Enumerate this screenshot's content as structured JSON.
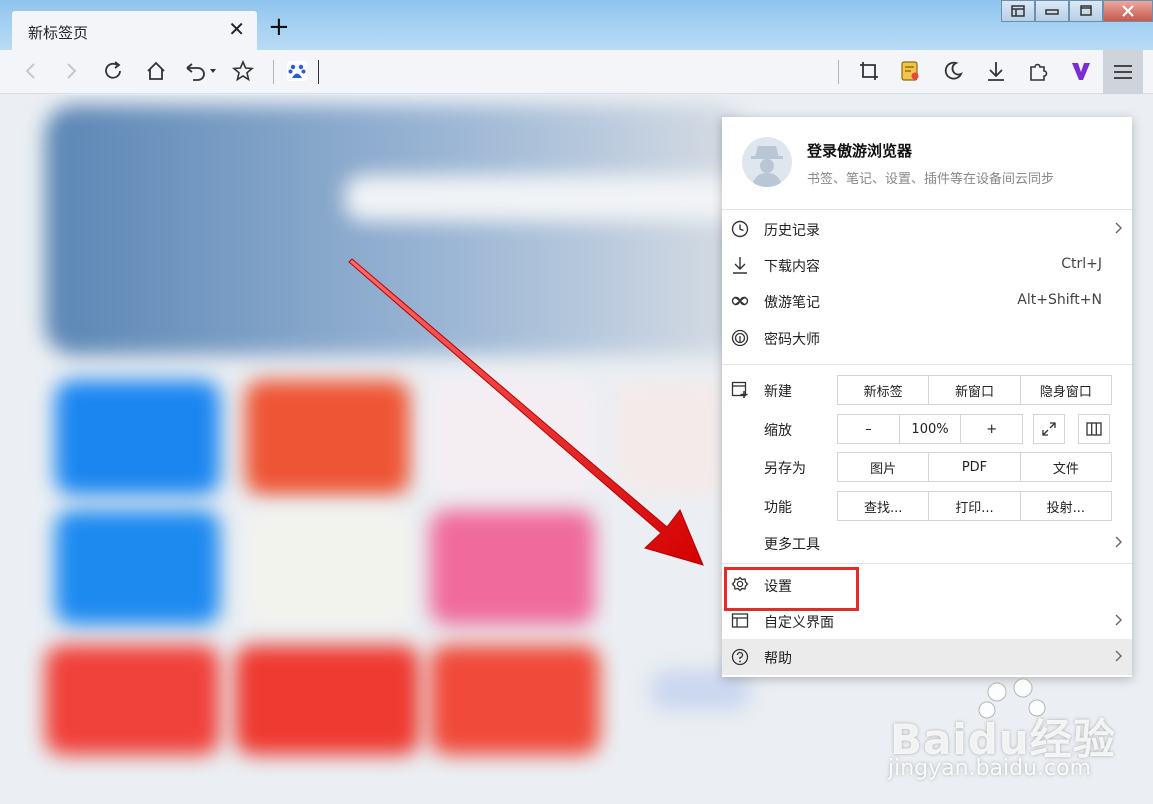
{
  "tab": {
    "title": "新标签页",
    "close": "✕"
  },
  "new_tab": "+",
  "menu": {
    "account": {
      "title": "登录傲游浏览器",
      "subtitle": "书签、笔记、设置、插件等在设备间云同步"
    },
    "items": {
      "history": {
        "label": "历史记录"
      },
      "downloads": {
        "label": "下载内容",
        "shortcut": "Ctrl+J"
      },
      "notes": {
        "label": "傲游笔记",
        "shortcut": "Alt+Shift+N"
      },
      "passwords": {
        "label": "密码大师"
      },
      "new": {
        "label": "新建",
        "options": [
          "新标签",
          "新窗口",
          "隐身窗口"
        ]
      },
      "zoom": {
        "label": "缩放",
        "minus": "–",
        "level": "100%",
        "plus": "+"
      },
      "save_as": {
        "label": "另存为",
        "options": [
          "图片",
          "PDF",
          "文件"
        ]
      },
      "functions": {
        "label": "功能",
        "options": [
          "查找...",
          "打印...",
          "投射..."
        ]
      },
      "more_tools": {
        "label": "更多工具"
      },
      "settings": {
        "label": "设置"
      },
      "customize": {
        "label": "自定义界面"
      },
      "help": {
        "label": "帮助"
      }
    }
  },
  "watermark": {
    "logo": "Baidu经验",
    "url": "jingyan.baidu.com"
  },
  "colors": {
    "accent_red": "#e52a2a",
    "titlebar": "#a9d3f3"
  }
}
